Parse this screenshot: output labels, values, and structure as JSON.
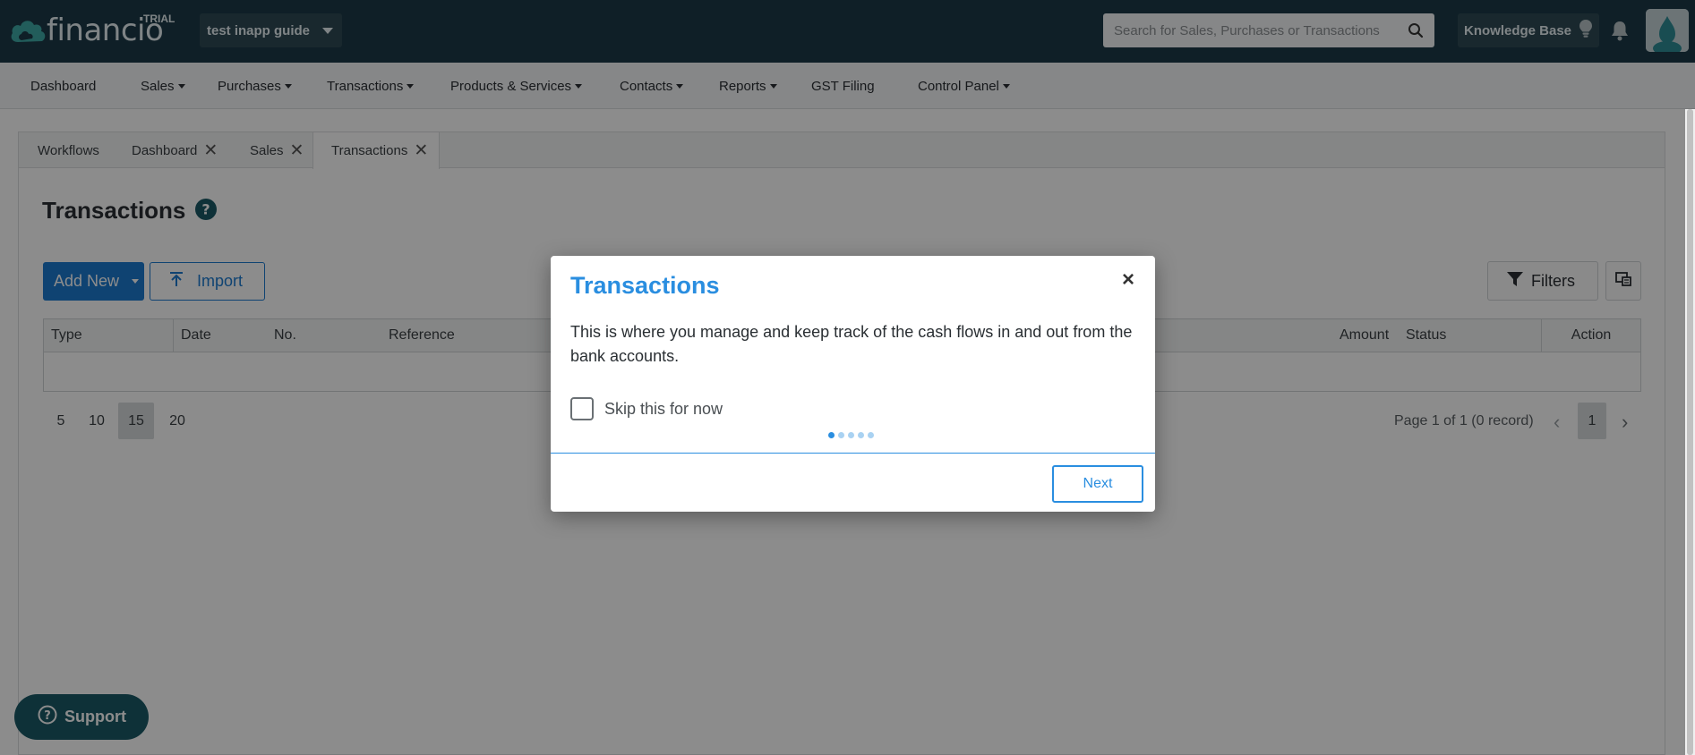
{
  "header": {
    "logo_text": "financio",
    "trial_badge": "TRIAL",
    "company_name": "test inapp guide",
    "search_placeholder": "Search for Sales, Purchases or Transactions",
    "knowledge_base": "Knowledge Base"
  },
  "nav": {
    "items": [
      {
        "label": "Dashboard"
      },
      {
        "label": "Sales"
      },
      {
        "label": "Purchases"
      },
      {
        "label": "Transactions"
      },
      {
        "label": "Products & Services"
      },
      {
        "label": "Contacts"
      },
      {
        "label": "Reports"
      },
      {
        "label": "GST Filing"
      },
      {
        "label": "Control Panel"
      }
    ]
  },
  "tabs": [
    {
      "label": "Workflows"
    },
    {
      "label": "Dashboard"
    },
    {
      "label": "Sales"
    },
    {
      "label": "Transactions"
    }
  ],
  "page": {
    "title": "Transactions",
    "add_new": "Add New",
    "import": "Import",
    "filters": "Filters"
  },
  "table": {
    "columns": [
      "Type",
      "Date",
      "No.",
      "Reference",
      "Amount",
      "Status",
      "Action"
    ]
  },
  "pagination": {
    "sizes": [
      "5",
      "10",
      "15",
      "20"
    ],
    "selected_size": "15",
    "info": "Page 1 of 1 (0 record)",
    "current_page": "1"
  },
  "support": {
    "label": "Support"
  },
  "modal": {
    "title": "Transactions",
    "body": "This is where you manage and keep track of the cash flows in and out from the bank accounts.",
    "skip_label": "Skip this for now",
    "next_label": "Next",
    "close_symbol": "×"
  },
  "colors": {
    "header_bg": "#1c3a47",
    "accent": "#2a8ee0",
    "primary_button": "#1d7bd0",
    "support_bg": "#1a5a66"
  }
}
